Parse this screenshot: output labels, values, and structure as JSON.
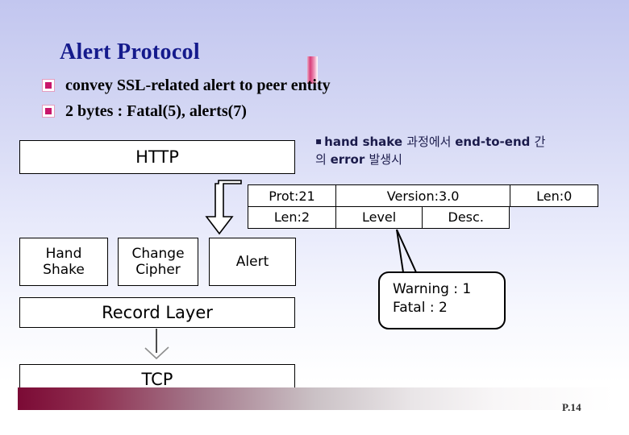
{
  "slide": {
    "title": "Alert Protocol",
    "page_number": "P.14",
    "title_color": "#141a8c",
    "accent_color": "#c8176b",
    "bottom_bar_color": "#7b0a35"
  },
  "bullets": [
    {
      "marker": "filled-square-bullet",
      "text": "convey SSL-related alert to peer entity"
    },
    {
      "marker": "filled-square-bullet",
      "text": "2 bytes : Fatal(5), alerts(7)"
    }
  ],
  "note": {
    "marker": "▪",
    "line1_a": "hand shake ",
    "line1_b": "과정에서 ",
    "line1_c": "end-to-end ",
    "line1_d": "간",
    "line2_a": "의 ",
    "line2_b": "error ",
    "line2_c": "발생시",
    "full_text": "▪ hand shake 과정에서 end-to-end 간의 error 발생시"
  },
  "stack": {
    "http": "HTTP",
    "hand_shake": "Hand\nShake",
    "hand_shake_line1": "Hand",
    "hand_shake_line2": "Shake",
    "change_cipher_line1": "Change",
    "change_cipher_line2": "Cipher",
    "alert": "Alert",
    "record_layer": "Record Layer",
    "tcp": "TCP"
  },
  "pdu_table": {
    "row1": [
      {
        "label": "Prot:21"
      },
      {
        "label": "Version:3.0"
      },
      {
        "label": "Len:0"
      }
    ],
    "row2": [
      {
        "label": "Len:2"
      },
      {
        "label": "Level"
      },
      {
        "label": "Desc."
      }
    ]
  },
  "callout": {
    "line1": "Warning : 1",
    "line2": "Fatal : 2"
  }
}
